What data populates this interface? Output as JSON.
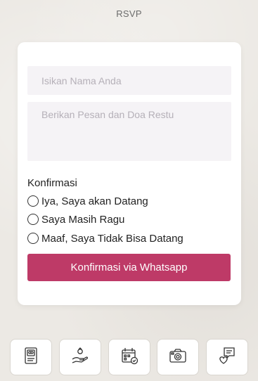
{
  "header": {
    "title": "RSVP"
  },
  "form": {
    "name_placeholder": "Isikan Nama Anda",
    "message_placeholder": "Berikan Pesan dan Doa Restu",
    "confirm_label": "Konfirmasi",
    "options": [
      "Iya, Saya akan Datang",
      "Saya Masih Ragu",
      "Maaf, Saya Tidak Bisa Datang"
    ],
    "submit_label": "Konfirmasi via Whatsapp"
  },
  "colors": {
    "accent": "#be3a67",
    "background": "#ece9e4"
  },
  "bottom_nav": [
    {
      "icon": "couple-card-icon"
    },
    {
      "icon": "ring-hand-icon"
    },
    {
      "icon": "calendar-icon"
    },
    {
      "icon": "camera-icon"
    },
    {
      "icon": "message-heart-icon"
    }
  ]
}
